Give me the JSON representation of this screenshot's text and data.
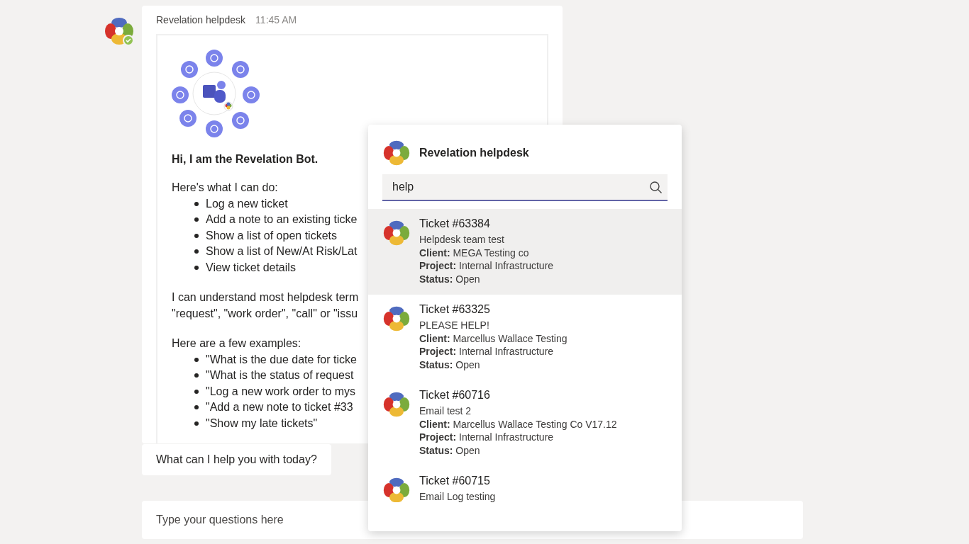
{
  "message": {
    "sender": "Revelation helpdesk",
    "time": "11:45 AM",
    "card": {
      "greeting": "Hi, I am the Revelation Bot.",
      "capabilities_intro": "Here's what I can do:",
      "capabilities": [
        "Log a new ticket",
        "Add a note to an existing ticke",
        "Show a list of open tickets",
        "Show a list of New/At Risk/Lat",
        "View ticket details"
      ],
      "terms_lines": [
        "I can understand most helpdesk term",
        "\"request\", \"work order\", \"call\" or \"issu"
      ],
      "examples_intro": "Here are a few examples:",
      "examples": [
        "\"What is the due date for ticke",
        "\"What is the status of request",
        "\"Log a new work order to mys",
        "\"Add a new note to ticket #33",
        "\"Show my late tickets\""
      ]
    }
  },
  "prompt_message": "What can I help you with today?",
  "compose": {
    "placeholder": "Type your questions here"
  },
  "popup": {
    "title": "Revelation helpdesk",
    "search": {
      "value": "help"
    },
    "results": [
      {
        "title": "Ticket #63384",
        "lines": [
          "Helpdesk team test",
          "**Client:** MEGA Testing co",
          "**Project:** Internal Infrastructure",
          "**Status:** Open"
        ],
        "selected": true
      },
      {
        "title": "Ticket #63325",
        "lines": [
          "PLEASE HELP!",
          "**Client:** Marcellus Wallace Testing",
          "**Project:** Internal Infrastructure",
          "**Status:** Open"
        ],
        "selected": false
      },
      {
        "title": "Ticket #60716",
        "lines": [
          "Email test 2",
          "**Client:** Marcellus Wallace Testing Co V17.12",
          "**Project:** Internal Infrastructure",
          "**Status:** Open"
        ],
        "selected": false
      },
      {
        "title": "Ticket #60715",
        "lines": [
          "Email Log testing"
        ],
        "selected": false
      }
    ]
  }
}
